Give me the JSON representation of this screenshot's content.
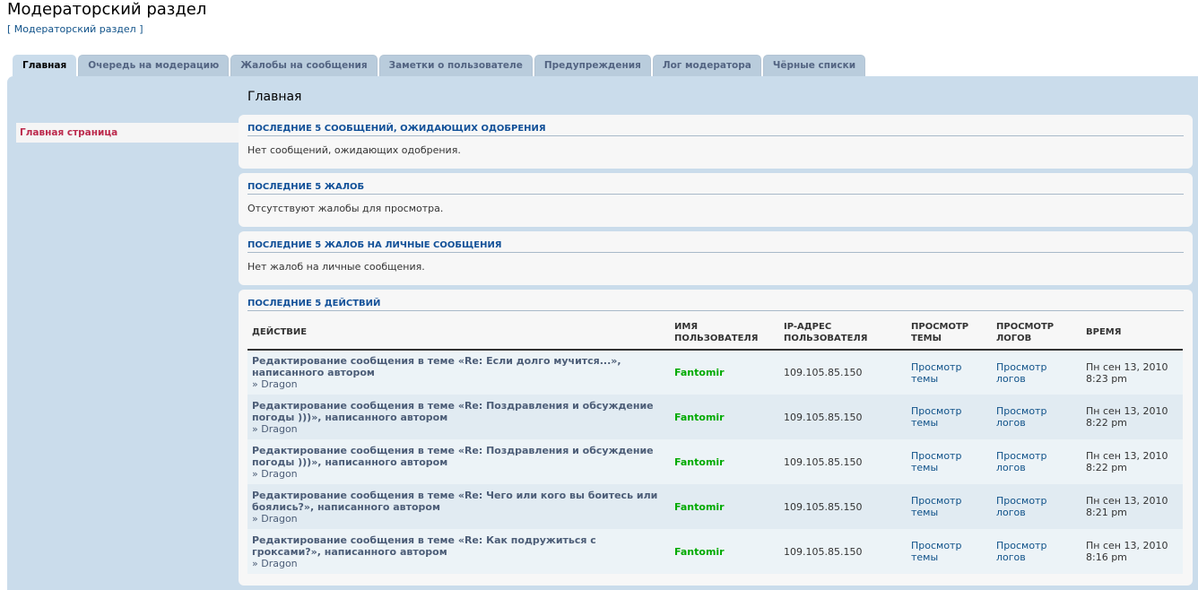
{
  "page_title": "Модераторский раздел",
  "breadcrumb": {
    "open": "[ ",
    "link": "Модераторский раздел",
    "close": " ]"
  },
  "tabs": [
    {
      "label": "Главная"
    },
    {
      "label": "Очередь на модерацию"
    },
    {
      "label": "Жалобы на сообщения"
    },
    {
      "label": "Заметки о пользователе"
    },
    {
      "label": "Предупреждения"
    },
    {
      "label": "Лог модератора"
    },
    {
      "label": "Чёрные списки"
    }
  ],
  "sidebar": {
    "item": "Главная страница"
  },
  "main_title": "Главная",
  "boxes": {
    "queue": {
      "title": "ПОСЛЕДНИЕ 5 СООБЩЕНИЙ, ОЖИДАЮЩИХ ОДОБРЕНИЯ",
      "text": "Нет сообщений, ожидающих одобрения."
    },
    "reports": {
      "title": "ПОСЛЕДНИЕ 5 ЖАЛОБ",
      "text": "Отсутствуют жалобы для просмотра."
    },
    "pm_reports": {
      "title": "ПОСЛЕДНИЕ 5 ЖАЛОБ НА ЛИЧНЫЕ СООБЩЕНИЯ",
      "text": "Нет жалоб на личные сообщения."
    },
    "actions": {
      "title": "ПОСЛЕДНИЕ 5 ДЕЙСТВИЙ"
    }
  },
  "table": {
    "headers": {
      "action": "ДЕЙСТВИЕ",
      "user": "ИМЯ ПОЛЬЗОВАТЕЛЯ",
      "ip": "IP-АДРЕС ПОЛЬЗОВАТЕЛЯ",
      "view_topic": "ПРОСМОТР ТЕМЫ",
      "view_logs": "ПРОСМОТР ЛОГОВ",
      "time": "ВРЕМЯ"
    },
    "rows": [
      {
        "action": "Редактирование сообщения в теме «Re: Если долго мучится...», написанного автором",
        "author": "» Dragon",
        "user": "Fantomir",
        "ip": "109.105.85.150",
        "view_topic": "Просмотр темы",
        "view_logs": "Просмотр логов",
        "time": "Пн сен 13, 2010 8:23 pm"
      },
      {
        "action": "Редактирование сообщения в теме «Re: Поздравления и обсуждение погоды )))», написанного автором",
        "author": "» Dragon",
        "user": "Fantomir",
        "ip": "109.105.85.150",
        "view_topic": "Просмотр темы",
        "view_logs": "Просмотр логов",
        "time": "Пн сен 13, 2010 8:22 pm"
      },
      {
        "action": "Редактирование сообщения в теме «Re: Поздравления и обсуждение погоды )))», написанного автором",
        "author": "» Dragon",
        "user": "Fantomir",
        "ip": "109.105.85.150",
        "view_topic": "Просмотр темы",
        "view_logs": "Просмотр логов",
        "time": "Пн сен 13, 2010 8:22 pm"
      },
      {
        "action": "Редактирование сообщения в теме «Re: Чего или кого вы боитесь или боялись?», написанного автором",
        "author": "» Dragon",
        "user": "Fantomir",
        "ip": "109.105.85.150",
        "view_topic": "Просмотр темы",
        "view_logs": "Просмотр логов",
        "time": "Пн сен 13, 2010 8:21 pm"
      },
      {
        "action": "Редактирование сообщения в теме «Re: Как подружиться с гроксами?», написанного автором",
        "author": "» Dragon",
        "user": "Fantomir",
        "ip": "109.105.85.150",
        "view_topic": "Просмотр темы",
        "view_logs": "Просмотр логов",
        "time": "Пн сен 13, 2010 8:16 pm"
      }
    ]
  }
}
